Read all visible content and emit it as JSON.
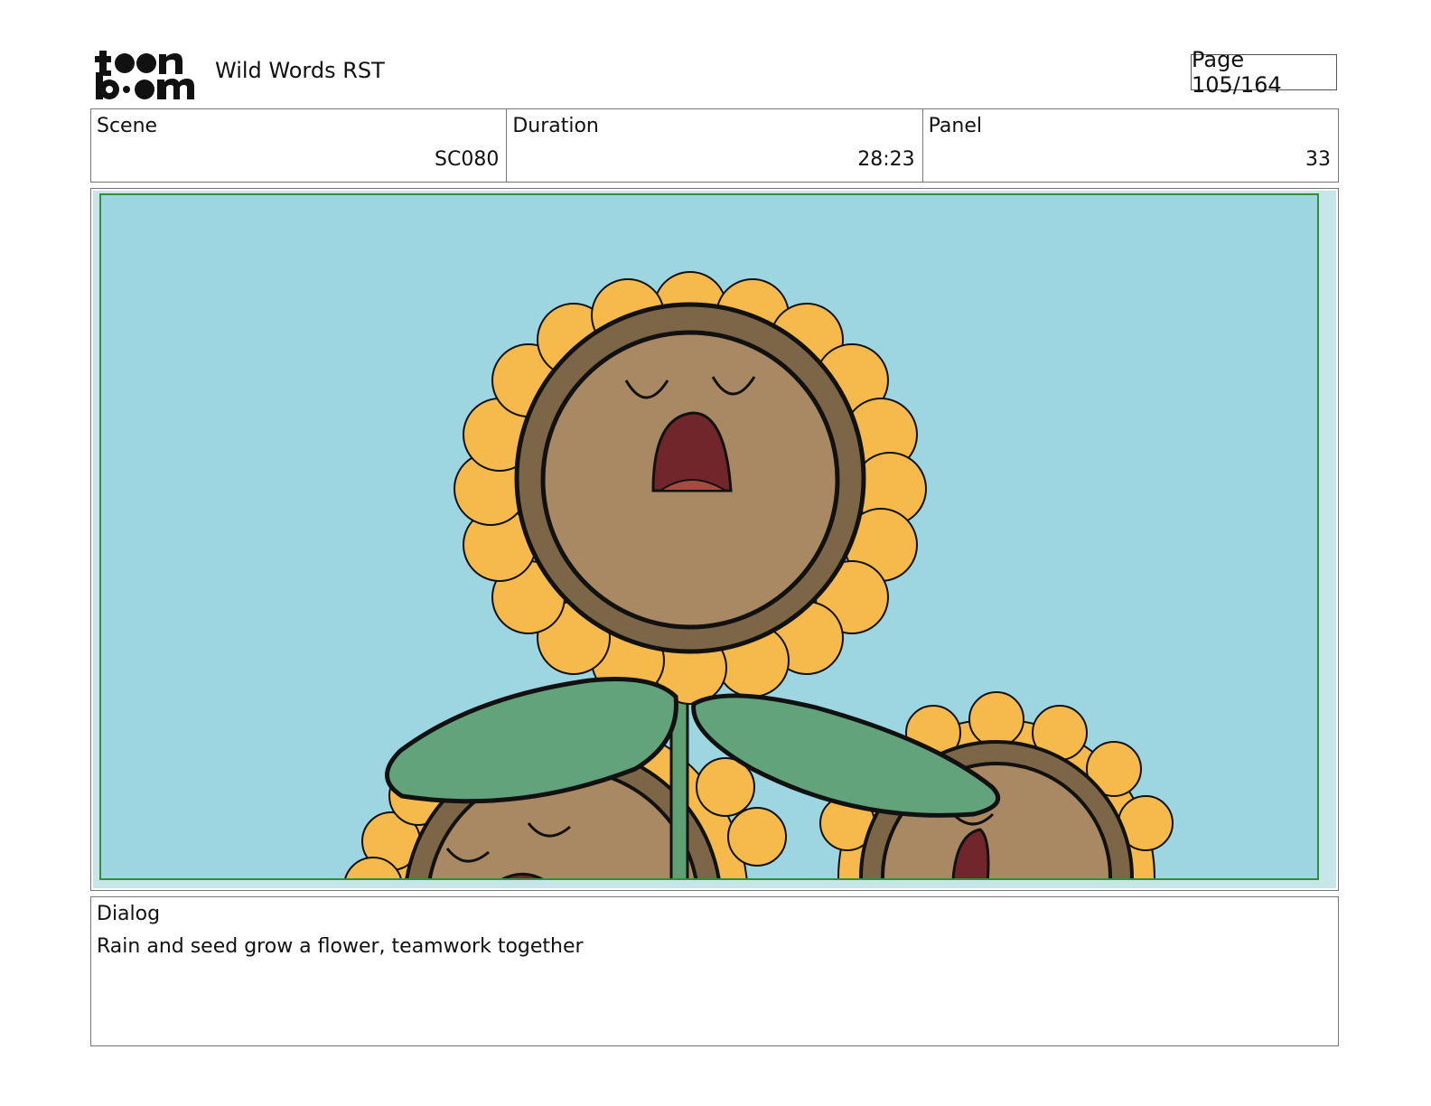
{
  "header": {
    "logo_text_top": "toon",
    "logo_text_bottom": "boom",
    "project_title": "Wild Words RST",
    "page_indicator": "Page 105/164"
  },
  "info": {
    "scene_label": "Scene",
    "scene_value": "SC080",
    "duration_label": "Duration",
    "duration_value": "28:23",
    "panel_label": "Panel",
    "panel_value": "33"
  },
  "panel_image": {
    "subject": "singing sunflowers",
    "colors": {
      "sky": "#9dd6e1",
      "frame_green": "#2f8f3e",
      "petal": "#f5b94c",
      "face_ring": "#7d6647",
      "face": "#a88963",
      "mouth": "#70262b",
      "leaf": "#62a37c",
      "stem": "#5e9f74"
    }
  },
  "dialog": {
    "label": "Dialog",
    "text": "Rain and seed grow a flower, teamwork together"
  }
}
